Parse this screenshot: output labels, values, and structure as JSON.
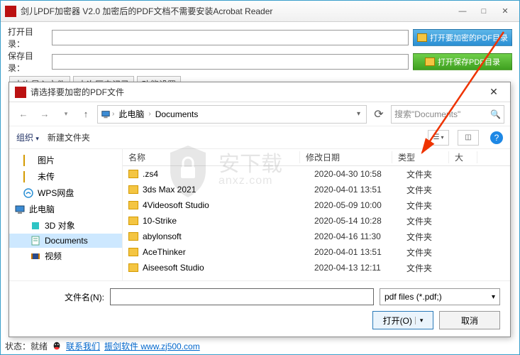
{
  "main": {
    "title": "剑儿PDF加密器  V2.0 加密后的PDF文档不需要安装Acrobat Reader",
    "open_dir_label": "打开目录：",
    "save_dir_label": "保存目录：",
    "btn_open_encrypt": "打开要加密的PDF目录",
    "btn_open_save": "打开保存PDF目录",
    "tabs": [
      "本次导入文件",
      "本次历史记录",
      "功能设置"
    ]
  },
  "status": {
    "label": "状态：就绪",
    "contact": "联系我们",
    "company": "振剑软件 www.zj500.com"
  },
  "dialog": {
    "title": "请选择要加密的PDF文件",
    "breadcrumb": {
      "root": "此电脑",
      "current": "Documents"
    },
    "search_placeholder": "搜索\"Documents\"",
    "organize": "组织",
    "new_folder": "新建文件夹",
    "columns": {
      "name": "名称",
      "date": "修改日期",
      "type": "类型",
      "size": "大"
    },
    "tree": [
      {
        "label": "图片",
        "kind": "folder"
      },
      {
        "label": "未传",
        "kind": "folder"
      },
      {
        "label": "WPS网盘",
        "kind": "wps"
      },
      {
        "label": "此电脑",
        "kind": "pc",
        "root": true
      },
      {
        "label": "3D 对象",
        "kind": "3d",
        "child": true
      },
      {
        "label": "Documents",
        "kind": "doc",
        "child": true,
        "selected": true
      },
      {
        "label": "视频",
        "kind": "video",
        "child": true
      }
    ],
    "files": [
      {
        "name": ".zs4",
        "date": "2020-04-30 10:58",
        "type": "文件夹"
      },
      {
        "name": "3ds Max 2021",
        "date": "2020-04-01 13:51",
        "type": "文件夹"
      },
      {
        "name": "4Videosoft Studio",
        "date": "2020-05-09 10:00",
        "type": "文件夹"
      },
      {
        "name": "10-Strike",
        "date": "2020-05-14 10:28",
        "type": "文件夹"
      },
      {
        "name": "abylonsoft",
        "date": "2020-04-16 11:30",
        "type": "文件夹"
      },
      {
        "name": "AceThinker",
        "date": "2020-04-01 13:51",
        "type": "文件夹"
      },
      {
        "name": "Aiseesoft Studio",
        "date": "2020-04-13 12:11",
        "type": "文件夹"
      }
    ],
    "filename_label": "文件名(N):",
    "filter": "pdf files (*.pdf;)",
    "open_btn": "打开(O)",
    "cancel_btn": "取消"
  },
  "watermark": {
    "text": "安下载",
    "sub": "anxz.com"
  }
}
